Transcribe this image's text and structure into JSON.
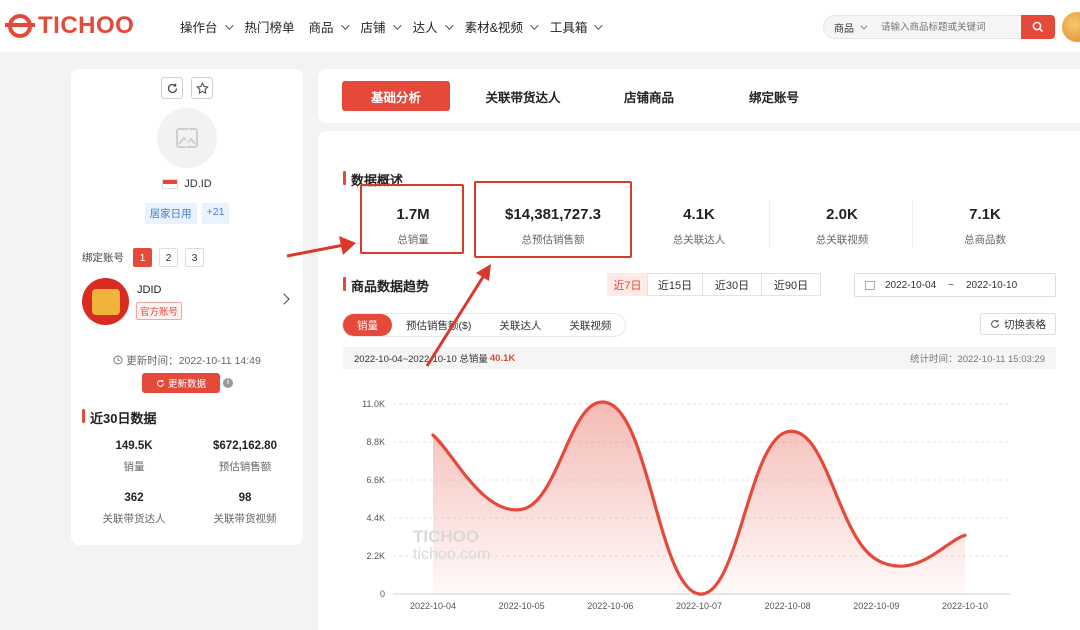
{
  "brand": {
    "name": "TICHOO"
  },
  "nav": {
    "items": [
      {
        "label": "操作台",
        "dropdown": true
      },
      {
        "label": "热门榜单",
        "dropdown": false
      },
      {
        "label": "商品",
        "dropdown": true
      },
      {
        "label": "店铺",
        "dropdown": true
      },
      {
        "label": "达人",
        "dropdown": true
      },
      {
        "label": "素材&视频",
        "dropdown": true
      },
      {
        "label": "工具箱",
        "dropdown": true
      }
    ]
  },
  "search": {
    "category": "商品",
    "placeholder": "请输入商品标题或关键词"
  },
  "shop": {
    "name": "JD.ID",
    "tags": [
      "居家日用",
      "+21"
    ],
    "bind_label": "绑定账号",
    "pages": [
      "1",
      "2",
      "3"
    ],
    "account": {
      "name": "JDID",
      "badge": "官方账号"
    },
    "update_time": "更新时间：2022-10-11 14:49",
    "update_button": "更新数据",
    "info_icon": "i"
  },
  "recent30": {
    "title": "近30日数据",
    "stats": [
      {
        "value": "149.5K",
        "label": "销量"
      },
      {
        "value": "$672,162.80",
        "label": "预估销售额"
      },
      {
        "value": "362",
        "label": "关联带货达人"
      },
      {
        "value": "98",
        "label": "关联带货视频"
      }
    ]
  },
  "tabs": [
    {
      "label": "基础分析",
      "active": true
    },
    {
      "label": "关联带货达人",
      "active": false
    },
    {
      "label": "店铺商品",
      "active": false
    },
    {
      "label": "绑定账号",
      "active": false
    }
  ],
  "overview": {
    "title": "数据概述",
    "kpis": [
      {
        "value": "1.7M",
        "label": "总销量"
      },
      {
        "value": "$14,381,727.3",
        "label": "总预估销售额"
      },
      {
        "value": "4.1K",
        "label": "总关联达人"
      },
      {
        "value": "2.0K",
        "label": "总关联视频"
      },
      {
        "value": "7.1K",
        "label": "总商品数"
      }
    ]
  },
  "trend": {
    "title": "商品数据趋势",
    "ranges": [
      "近7日",
      "近15日",
      "近30日",
      "近90日"
    ],
    "active_range": 0,
    "date_from": "2022-10-04",
    "date_sep": "~",
    "date_to": "2022-10-10",
    "metrics": [
      "销量",
      "预估销售额($)",
      "关联达人",
      "关联视频"
    ],
    "active_metric": 0,
    "switch_label": "切换表格",
    "summary_prefix": "2022-10-04~2022-10-10 总销量",
    "summary_value": "40.1K",
    "stat_time": "统计时间：2022-10-11 15:03:29"
  },
  "watermark": {
    "line1": "TICHOO",
    "line2": "tichoo.com"
  },
  "colors": {
    "accent": "#e4493a",
    "tag_blue": "#3f7fd8"
  },
  "chart_data": {
    "type": "area",
    "x": [
      "2022-10-04",
      "2022-10-05",
      "2022-10-06",
      "2022-10-07",
      "2022-10-08",
      "2022-10-09",
      "2022-10-10"
    ],
    "series": [
      {
        "values": [
          9200,
          4900,
          11000,
          0,
          9400,
          2000,
          3400
        ]
      }
    ],
    "ytick_labels": [
      "0",
      "2.2K",
      "4.4K",
      "6.6K",
      "8.8K",
      "11.0K"
    ],
    "ylim": [
      0,
      11000
    ],
    "grid": true,
    "smooth": true
  }
}
